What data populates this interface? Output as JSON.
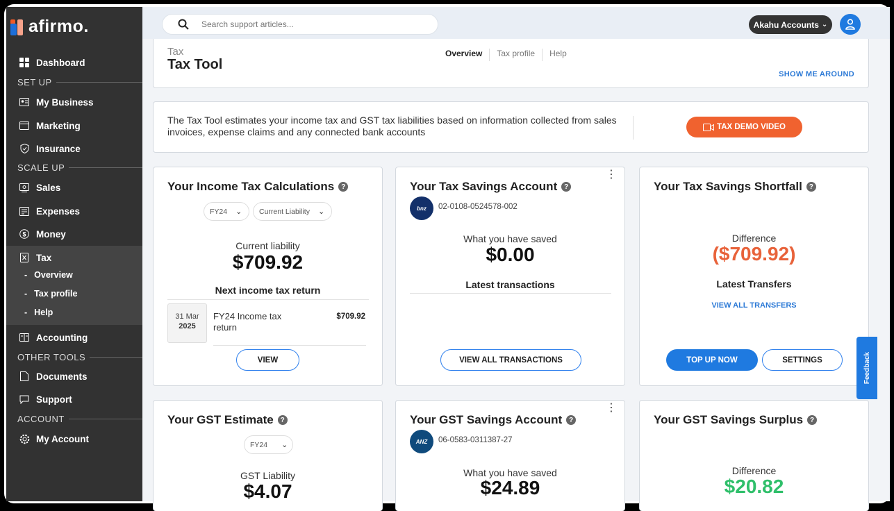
{
  "brand": {
    "name": "afirmo."
  },
  "sidebar": {
    "dashboard": "Dashboard",
    "sections": [
      "SET UP",
      "SCALE UP",
      "OTHER TOOLS",
      "ACCOUNT"
    ],
    "items": {
      "my_business": "My Business",
      "marketing": "Marketing",
      "insurance": "Insurance",
      "sales": "Sales",
      "expenses": "Expenses",
      "money": "Money",
      "tax": "Tax",
      "accounting": "Accounting",
      "documents": "Documents",
      "support": "Support",
      "my_account": "My Account"
    },
    "tax_sub": [
      "Overview",
      "Tax profile",
      "Help"
    ]
  },
  "topbar": {
    "search_placeholder": "Search support articles...",
    "account_label": "Akahu Accounts"
  },
  "header": {
    "breadcrumb": "Tax",
    "title": "Tax Tool",
    "tabs": [
      "Overview",
      "Tax profile",
      "Help"
    ],
    "show_me_around": "SHOW ME AROUND"
  },
  "info": {
    "text": "The Tax Tool estimates your income tax and GST tax liabilities based on information collected from sales invoices, expense claims and any connected bank accounts",
    "demo_button": "TAX DEMO VIDEO"
  },
  "income_tax": {
    "title": "Your Income Tax Calculations",
    "year": "FY24",
    "mode": "Current Liability",
    "label": "Current liability",
    "amount": "$709.92",
    "next_return": "Next income tax return",
    "date_day": "31 Mar",
    "date_year": "2025",
    "return_name": "FY24 Income tax return",
    "return_amount": "$709.92",
    "view": "VIEW"
  },
  "tax_savings": {
    "title": "Your Tax Savings Account",
    "bank_logo": "bnz",
    "account_number": "02-0108-0524578-002",
    "label": "What you have saved",
    "amount": "$0.00",
    "latest": "Latest transactions",
    "button": "VIEW ALL TRANSACTIONS"
  },
  "shortfall": {
    "title": "Your Tax Savings Shortfall",
    "label": "Difference",
    "amount": "($709.92)",
    "latest": "Latest Transfers",
    "view_all": "VIEW ALL TRANSFERS",
    "top_up": "TOP UP NOW",
    "settings": "SETTINGS",
    "color": "#e8623a"
  },
  "gst_estimate": {
    "title": "Your GST Estimate",
    "year": "FY24",
    "label": "GST Liability",
    "amount": "$4.07"
  },
  "gst_savings": {
    "title": "Your GST Savings Account",
    "bank_logo": "ANZ",
    "account_number": "06-0583-0311387-27",
    "label": "What you have saved",
    "amount": "$24.89"
  },
  "gst_surplus": {
    "title": "Your GST Savings Surplus",
    "label": "Difference",
    "amount": "$20.82",
    "color": "#2fbf6a"
  },
  "feedback": "Feedback"
}
